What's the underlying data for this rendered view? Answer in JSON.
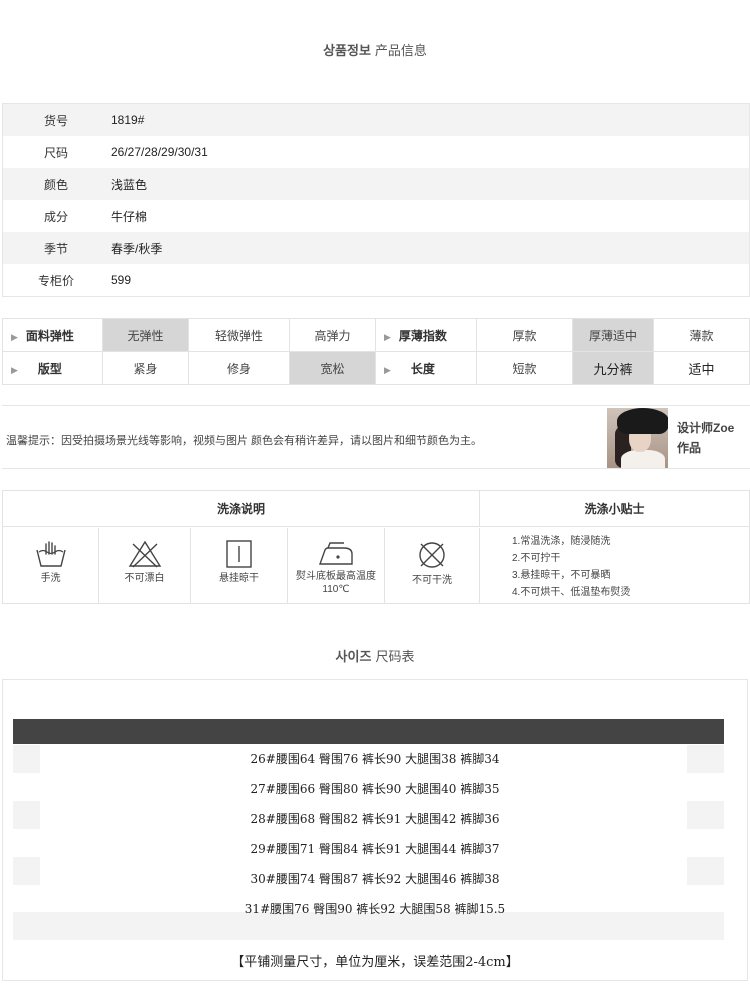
{
  "product_section": {
    "title_kr": "상품정보",
    "title_cn": "产品信息"
  },
  "product_info": [
    {
      "key": "货号",
      "value": "1819#"
    },
    {
      "key": "尺码",
      "value": "26/27/28/29/30/31"
    },
    {
      "key": "颜色",
      "value": "浅蓝色"
    },
    {
      "key": "成分",
      "value": "牛仔棉"
    },
    {
      "key": "季节",
      "value": "春季/秋季"
    },
    {
      "key": "专柜价",
      "value": "599"
    }
  ],
  "properties": {
    "row1": {
      "head_a": "面料弹性",
      "a": [
        "无弹性",
        "轻微弹性",
        "高弹力"
      ],
      "a_selected": "无弹性",
      "head_b": "厚薄指数",
      "b": [
        "厚款",
        "厚薄适中",
        "薄款"
      ],
      "b_selected": "厚薄适中"
    },
    "row2": {
      "head_a": "版型",
      "a": [
        "紧身",
        "修身",
        "宽松"
      ],
      "a_selected": "宽松",
      "head_b": "长度",
      "b": [
        "短款",
        "九分裤",
        "适中"
      ],
      "b_selected": "九分裤"
    }
  },
  "notice": {
    "text": "温馨提示：因受拍摄场景光线等影响，视频与图片 颜色会有稍许差异，请以图片和细节颜色为主。",
    "designer_line1": "设计师Zoe",
    "designer_line2": "作品"
  },
  "care": {
    "title_left": "洗涤说明",
    "title_right": "洗涤小贴士",
    "items": [
      {
        "icon": "hand-wash-icon",
        "label": "手洗"
      },
      {
        "icon": "no-bleach-icon",
        "label": "不可漂白"
      },
      {
        "icon": "hang-dry-icon",
        "label": "悬挂晾干"
      },
      {
        "icon": "iron-icon",
        "label": "熨斗底板最高温度110℃"
      },
      {
        "icon": "no-dry-clean-icon",
        "label": "不可干洗"
      }
    ],
    "tips": [
      "1.常温洗涤，随浸随洗",
      "2.不可拧干",
      "3.悬挂晾干，不可暴晒",
      "4.不可烘干、低温垫布熨烫"
    ]
  },
  "size_section": {
    "title_kr": "사이즈",
    "title_cn": "尺码表",
    "rows": [
      "26#腰围64 臀围76 裤长90 大腿围38 裤脚34",
      "27#腰围66 臀围80 裤长90 大腿围40 裤脚35",
      "28#腰围68 臀围82 裤长91 大腿围42 裤脚36",
      "29#腰围71 臀围84 裤长91 大腿围44 裤脚37",
      "30#腰围74 臀围87 裤长92 大腿围46 裤脚38",
      "31#腰围76 臀围90 裤长92 大腿围58 裤脚15.5"
    ],
    "footnote": "【平铺测量尺寸，单位为厘米，误差范围2-4cm】"
  }
}
